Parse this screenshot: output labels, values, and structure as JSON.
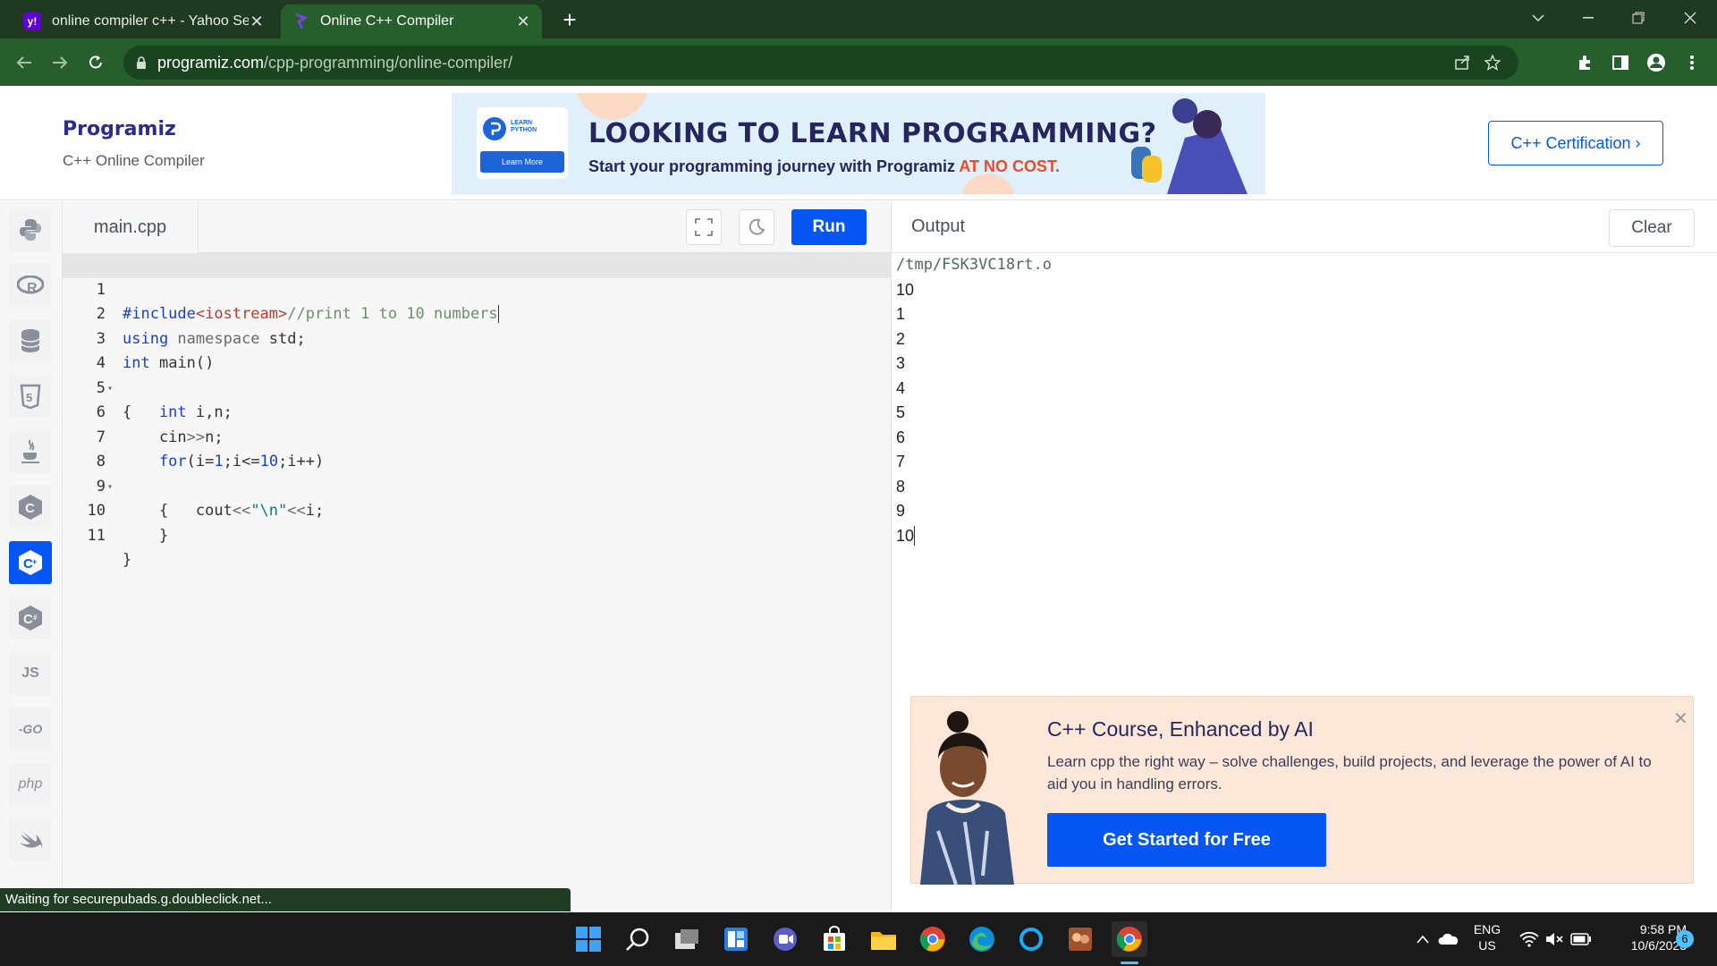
{
  "browser": {
    "tabs": [
      {
        "title": "online compiler c++ - Yahoo Se",
        "favicon": "yahoo-icon",
        "active": false
      },
      {
        "title": "Online C++ Compiler",
        "favicon": "programiz-icon",
        "active": true
      }
    ],
    "url_host": "programiz.com",
    "url_path": "/cpp-programming/online-compiler/"
  },
  "header": {
    "logo": "Programiz",
    "subtitle": "C++ Online Compiler",
    "cert_button": "C++ Certification ›",
    "banner": {
      "badge_line1": "LEARN",
      "badge_line2": "PYTHON",
      "badge_button": "Learn More",
      "headline": "LOOKING TO LEARN PROGRAMMING?",
      "subline_prefix": "Start your programming journey with Programiz ",
      "subline_highlight": "AT NO COST."
    }
  },
  "sidebar": {
    "items": [
      {
        "name": "python-icon",
        "label": ""
      },
      {
        "name": "r-lang-icon",
        "label": "R"
      },
      {
        "name": "database-icon",
        "label": ""
      },
      {
        "name": "html5-icon",
        "label": "5"
      },
      {
        "name": "java-icon",
        "label": "♨"
      },
      {
        "name": "c-lang-icon",
        "label": "C"
      },
      {
        "name": "cpp-lang-icon",
        "label": "C+"
      },
      {
        "name": "csharp-lang-icon",
        "label": "C#"
      },
      {
        "name": "javascript-icon",
        "label": "JS"
      },
      {
        "name": "go-lang-icon",
        "label": "-GO"
      },
      {
        "name": "php-icon",
        "label": "php"
      },
      {
        "name": "swift-icon",
        "label": ""
      }
    ],
    "active_index": 6
  },
  "editor": {
    "file_tab": "main.cpp",
    "run_label": "Run",
    "lines": [
      {
        "n": "1",
        "fold": ""
      },
      {
        "n": "2",
        "fold": ""
      },
      {
        "n": "3",
        "fold": ""
      },
      {
        "n": "4",
        "fold": "▾"
      },
      {
        "n": "5",
        "fold": ""
      },
      {
        "n": "6",
        "fold": ""
      },
      {
        "n": "7",
        "fold": ""
      },
      {
        "n": "8",
        "fold": "▾"
      },
      {
        "n": "9",
        "fold": ""
      },
      {
        "n": "10",
        "fold": ""
      },
      {
        "n": "11",
        "fold": ""
      }
    ],
    "code": {
      "l1_a": "#include",
      "l1_b": "<iostream>",
      "l1_c": "//print 1 to 10 numbers",
      "l2_a": "using",
      "l2_b": " namespace",
      "l2_c": " std;",
      "l3_a": "int",
      "l3_b": " main()",
      "l4": "{",
      "l5_a": "    int",
      "l5_b": " i,n;",
      "l6_a": "    cin",
      "l6_b": ">>",
      "l6_c": "n;",
      "l7_a": "    for",
      "l7_b": "(i=",
      "l7_c": "1",
      "l7_d": ";i<=",
      "l7_e": "10",
      "l7_f": ";i++)",
      "l8": "    {",
      "l9_a": "        cout",
      "l9_b": "<<",
      "l9_c": "\"\\n\"",
      "l9_d": "<<",
      "l9_e": "i;",
      "l10": "    }",
      "l11": "}"
    }
  },
  "output": {
    "label": "Output",
    "clear_label": "Clear",
    "lines": [
      "/tmp/FSK3VC18rt.o",
      "10",
      "1",
      "2",
      "3",
      "4",
      "5",
      "6",
      "7",
      "8",
      "9",
      "10"
    ]
  },
  "promo": {
    "title": "C++ Course, Enhanced by AI",
    "description": "Learn cpp the right way – solve challenges, build projects, and leverage the power of AI to aid you in handling errors.",
    "cta": "Get Started for Free"
  },
  "status_bar": "Waiting for securepubads.g.doubleclick.net...",
  "taskbar": {
    "lang_line1": "ENG",
    "lang_line2": "US",
    "time": "9:58 PM",
    "date": "10/6/2023",
    "notification_count": "6"
  },
  "colors": {
    "chrome_frame": "#1e3a21",
    "chrome_toolbar": "#265e2c",
    "accent_blue": "#0556f3",
    "promo_bg": "#fde7d9"
  }
}
